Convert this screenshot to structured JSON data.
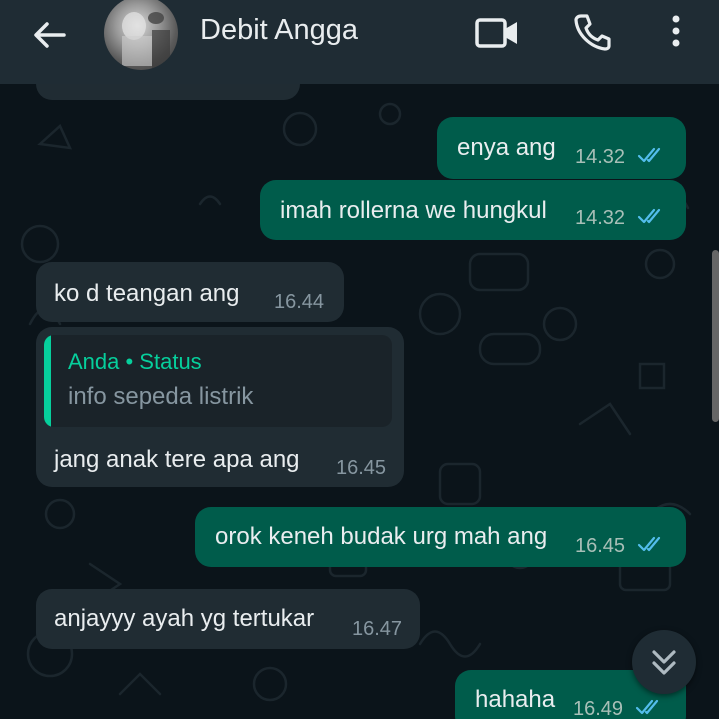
{
  "header": {
    "contact_name": "Debit Angga",
    "back_icon": "arrow-left-icon",
    "video_icon": "video-camera-icon",
    "call_icon": "phone-icon",
    "menu_icon": "more-vert-icon"
  },
  "messages": [
    {
      "direction": "out",
      "text": "enya ang",
      "time": "14.32",
      "status": "read"
    },
    {
      "direction": "out",
      "text": "imah rollerna we hungkul",
      "time": "14.32",
      "status": "read"
    },
    {
      "direction": "in",
      "text": "ko d teangan ang",
      "time": "16.44"
    },
    {
      "direction": "in",
      "text": "jang anak tere apa ang",
      "time": "16.45",
      "reply": {
        "title": "Anda • Status",
        "text": "info sepeda listrik"
      }
    },
    {
      "direction": "out",
      "text": "orok keneh budak urg mah ang",
      "time": "16.45",
      "status": "read"
    },
    {
      "direction": "in",
      "text": "anjayyy ayah yg tertukar",
      "time": "16.47"
    },
    {
      "direction": "out",
      "text": "hahaha",
      "time": "16.49",
      "status": "read"
    }
  ],
  "scroll_button_icon": "chevron-double-down-icon",
  "colors": {
    "header_bg": "#1f2c34",
    "chat_bg": "#0b141a",
    "outgoing_bubble": "#005c4b",
    "incoming_bubble": "#202c33",
    "read_tick": "#53bdeb",
    "accent": "#06cf9c"
  }
}
